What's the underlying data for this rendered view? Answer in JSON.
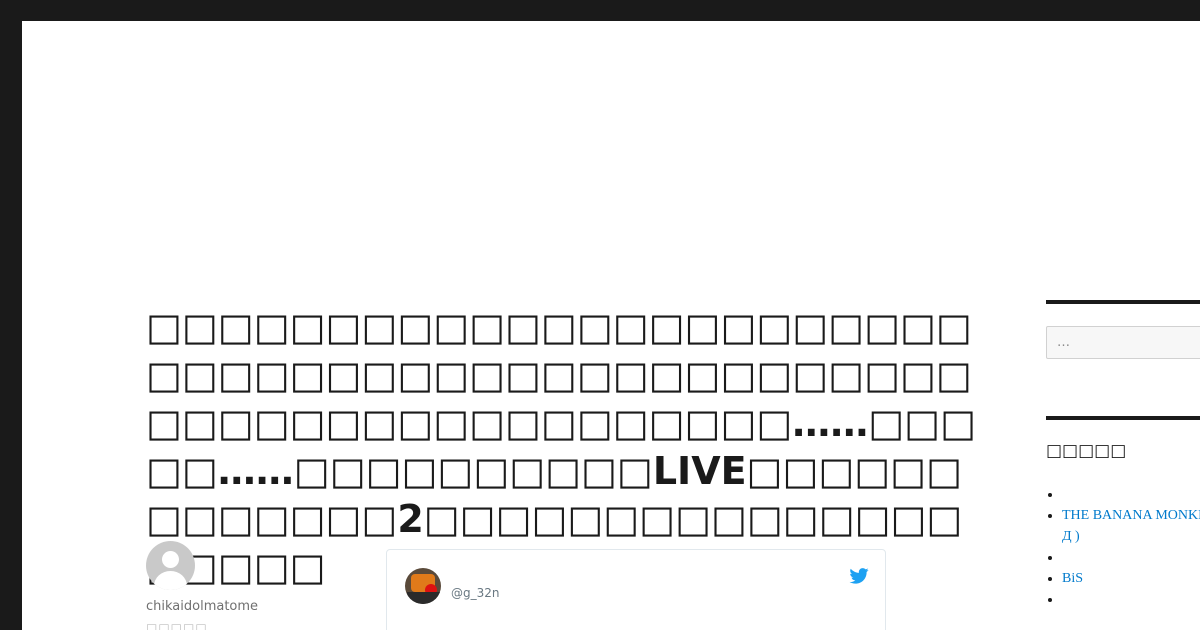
{
  "article": {
    "title": "□□□□□□□□□□□□□□□□□□□□□□□□□□□□□□□□□□□□□□□□□□□□□□□□□□□□□□□□□□□□□□□□……□□□□□……□□□□□□□□□□LIVE□□□□□□□□□□□□□2□□□□□□□□□□□□□□□□□□□□",
    "author": {
      "name": "chikaidolmatome",
      "meta": "□□□□□"
    }
  },
  "tweet": {
    "handle": "@g_32n",
    "icon": "twitter-bird-icon",
    "color": "#1da1f2"
  },
  "sidebar": {
    "search_placeholder": "…",
    "widget_title": "□□□□□",
    "items": [
      {
        "label": ""
      },
      {
        "label": "THE BANANA MONKEYS",
        "label2": "Д  )"
      },
      {
        "label": ""
      },
      {
        "label": "BiS"
      },
      {
        "label": ""
      }
    ],
    "link_color": "#007acc"
  }
}
